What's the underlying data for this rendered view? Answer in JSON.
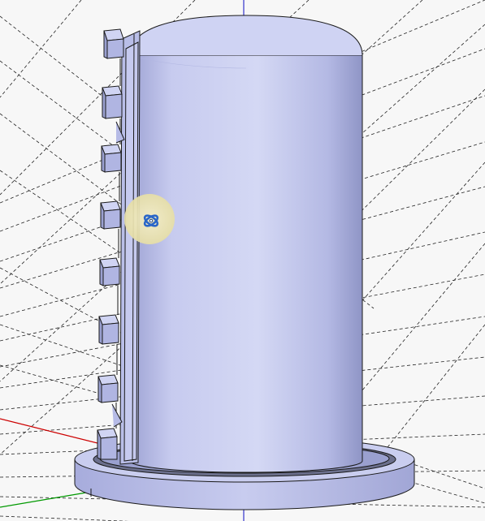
{
  "app": {
    "view": "3d-modeling-viewport"
  },
  "scene": {
    "model": "cylinder-with-base-and-stepped-rail",
    "cursor_icon": "orbit-icon",
    "colors": {
      "background": "#f7f7f7",
      "face_light": "#d4d8f2",
      "face_mid": "#b6bce6",
      "face_shadow": "#8e94c4",
      "edge": "#1a1a1a",
      "guide_lines": "#222222",
      "axis_red": "#cc0000",
      "axis_green": "#009900",
      "axis_blue": "#3333cc",
      "cursor_halo": "#f1e9b4",
      "cursor_icon": "#2a66c8"
    }
  }
}
